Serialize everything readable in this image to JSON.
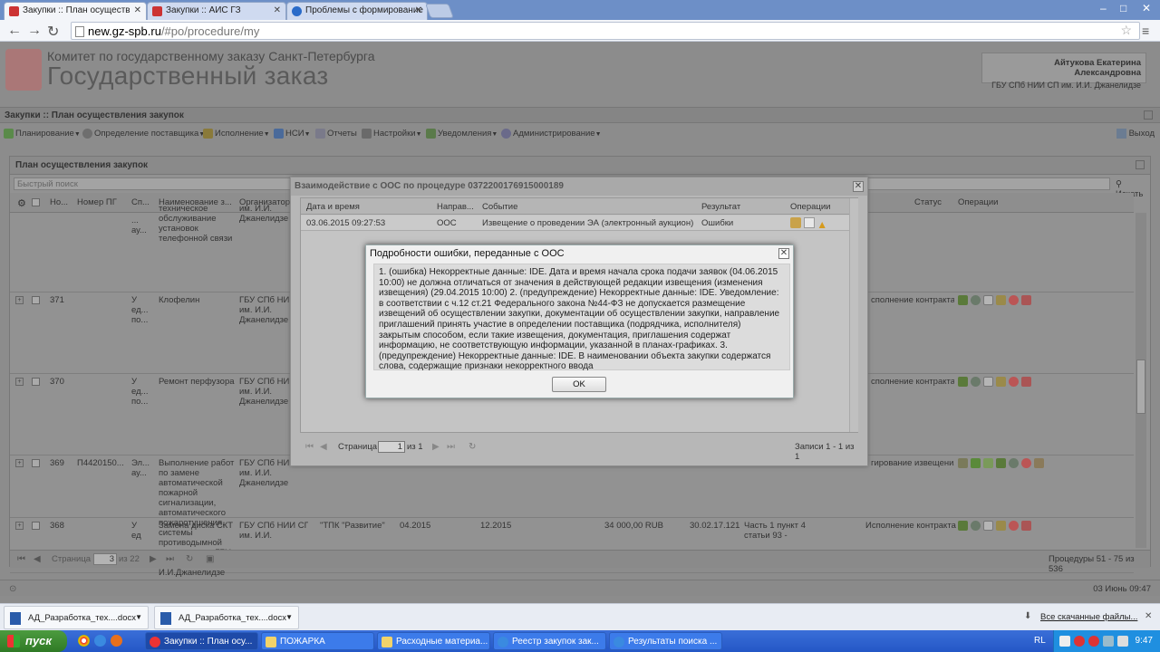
{
  "browser": {
    "tabs": [
      {
        "title": "Закупки :: План осуществ",
        "active": true
      },
      {
        "title": "Закупки :: АИС ГЗ",
        "active": false
      },
      {
        "title": "Проблемы с формирование",
        "active": false
      }
    ],
    "url_host": "new.gz-spb.ru",
    "url_path": "/#po/procedure/my",
    "win_min": "–",
    "win_max": "□",
    "win_close": "✕"
  },
  "header": {
    "org_line": "Комитет по государственному заказу Санкт-Петербурга",
    "system_title": "Государственный заказ",
    "user_name": "Айтукова Екатерина Александровна",
    "user_org": "ГБУ СПб НИИ СП им. И.И. Джанелидзе"
  },
  "section_title": "Закупки :: План осуществления закупок",
  "menu": [
    {
      "label": "Планирование",
      "dropdown": true
    },
    {
      "label": "Определение поставщика",
      "dropdown": true
    },
    {
      "label": "Исполнение",
      "dropdown": true
    },
    {
      "label": "НСИ",
      "dropdown": true
    },
    {
      "label": "Отчеты",
      "dropdown": false
    },
    {
      "label": "Настройки",
      "dropdown": true
    },
    {
      "label": "Уведомления",
      "dropdown": true
    },
    {
      "label": "Администрирование",
      "dropdown": true
    }
  ],
  "exit_label": "Выход",
  "panel": {
    "title": "План осуществления закупок",
    "search_placeholder": "Быстрый поиск",
    "search_button": "Искать",
    "columns": [
      "Но...",
      "Номер ПГ",
      "Сп...",
      "Наименование з...",
      "Организатор",
      "Статус",
      "Операции"
    ],
    "rows": [
      {
        "num": "",
        "pg": "",
        "sp": "...\nау...",
        "name": "техническое\nобслуживание\nустановок\nтелефонной связи",
        "org": "им. И.И.\nДжанелидзе",
        "status": ""
      },
      {
        "num": "371",
        "pg": "",
        "sp": "У\nед...\nпо...",
        "name": "Клофелин",
        "org": "ГБУ СПб НИИ\nим. И.И.\nДжанелидзе",
        "status": "сполнение контракта"
      },
      {
        "num": "370",
        "pg": "",
        "sp": "У\nед...\nпо...",
        "name": "Ремонт перфузора",
        "org": "ГБУ СПб НИИ\nим. И.И.\nДжанелидзе",
        "status": "сполнение контракта"
      },
      {
        "num": "369",
        "pg": "П4420150...",
        "sp": "Эл...\nау...",
        "name": "Выполнение работ\nпо замене\nавтоматической\nпожарной\nсигнализации,\nавтоматического\nпожаротушения,\nсистемы\nпротиводымной\nвентиляции в ГБУ\nСПб НИИ СП им.\nИ.И.Джанелидзе",
        "org": "ГБУ СПб НИИ\nим. И.И.\nДжанелидзе",
        "status": "гирование извещения"
      },
      {
        "num": "368",
        "pg": "",
        "sp": "У\nед",
        "name": "Замена диска СКТ",
        "org": "ГБУ СПб НИИ СП\nим. И.И.",
        "extra": {
          "supplier": "\"ТПК \"Развитие\"",
          "d1": "04.2015",
          "d2": "12.2015",
          "sum": "34 000,00 RUB",
          "code": "30.02.17.121",
          "basis": "Часть 1 пункт 4\nстатьи 93 -"
        },
        "status": "Исполнение контракта"
      }
    ],
    "pager": {
      "page_label": "Страница",
      "page": "3",
      "of_label": "из 22",
      "records": "Процедуры 51 - 75 из 536"
    }
  },
  "footer_date": "03 Июнь 09:47",
  "dialog_ooc": {
    "title": "Взаимодействие с ООС по процедуре 0372200176915000189",
    "columns": [
      "Дата и время",
      "Направ...",
      "Событие",
      "Результат",
      "Операции"
    ],
    "row": {
      "datetime": "03.06.2015 09:27:53",
      "direction": "ООС",
      "event": "Извещение о проведении ЭА (электронный аукцион)",
      "result": "Ошибки"
    },
    "pager": {
      "page_label": "Страница",
      "page": "1",
      "of_label": "из 1",
      "records": "Записи 1 - 1 из 1"
    }
  },
  "dialog_error": {
    "title": "Подробности ошибки, переданные с ООС",
    "message": "1. (ошибка) Некорректные данные: IDE. Дата и время начала срока подачи заявок (04.06.2015 10:00) не должна отличаться от значения в действующей редакции извещения (изменения извещения) (29.04.2015 10:00) 2. (предупреждение) Некорректные данные: IDE. Уведомление: в соответствии с ч.12 ст.21 Федерального закона №44-ФЗ не допускается размещение извещений об осуществлении закупки, документации об осуществлении закупки, направление приглашений принять участие в определении поставщика (подрядчика, исполнителя) закрытым способом, если такие извещения, документация, приглашения содержат информацию, не соответствующую информации, указанной в планах-графиках. 3. (предупреждение) Некорректные данные: IDE. В наименовании объекта закупки содержатся слова, содержащие признаки некорректного ввода",
    "ok_label": "OK"
  },
  "downloads": {
    "items": [
      "АД_Разработка_тех....docx",
      "АД_Разработка_тех....docx"
    ],
    "all_label": "Все скачанные файлы..."
  },
  "taskbar": {
    "start_label": "пуск",
    "buttons": [
      "Закупки :: План осу...",
      "ПОЖАРКА",
      "Расходные материа...",
      "Реестр закупок зак...",
      "Результаты поиска ..."
    ],
    "lang": "RL",
    "time": "9:47"
  },
  "colors": {
    "taskbar": "#2457c6",
    "start": "#2f7a25",
    "error_dialog": "#f0f0f0",
    "overlay_page": "#8c8c8c"
  }
}
